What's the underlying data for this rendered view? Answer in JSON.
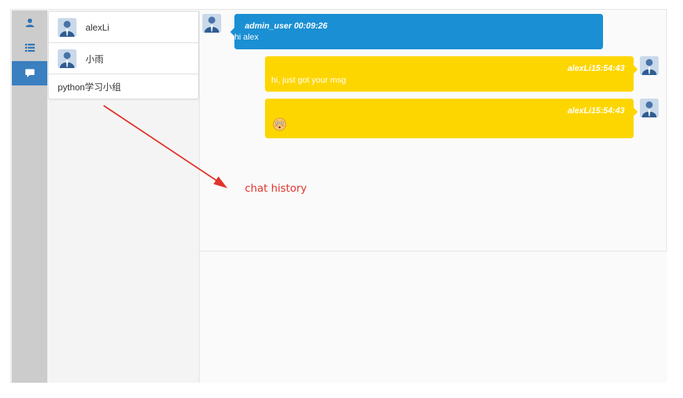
{
  "sidebar": {
    "buttons": [
      {
        "icon": "user-icon",
        "active": false
      },
      {
        "icon": "list-icon",
        "active": false
      },
      {
        "icon": "chat-bubble-icon",
        "active": true
      }
    ]
  },
  "contacts": [
    {
      "name": "alexLi",
      "avatar": "user-avatar",
      "type": "user"
    },
    {
      "name": "小雨",
      "avatar": "user-avatar",
      "type": "user"
    },
    {
      "name": "python学习小组",
      "type": "group"
    }
  ],
  "messages": [
    {
      "direction": "incoming",
      "sender": "admin_user",
      "time": "00:09:26",
      "meta": "admin_user 00:09:26",
      "text": "hi alex"
    },
    {
      "direction": "outgoing",
      "sender": "alexLi",
      "time": "15:54:43",
      "meta": "alexLi15:54:43",
      "text": "hi, just got your msg"
    },
    {
      "direction": "outgoing",
      "sender": "alexLi",
      "time": "15:54:43",
      "meta": "alexLi15:54:43",
      "text": "",
      "emoji": "dizzy-face-emoji"
    }
  ],
  "annotation": {
    "text": "chat history"
  },
  "colors": {
    "rail_bg": "#cccccc",
    "rail_active": "#3a7fbf",
    "incoming_bubble": "#1a8fd3",
    "outgoing_bubble": "#fdd600",
    "annotation": "#e0352b"
  }
}
